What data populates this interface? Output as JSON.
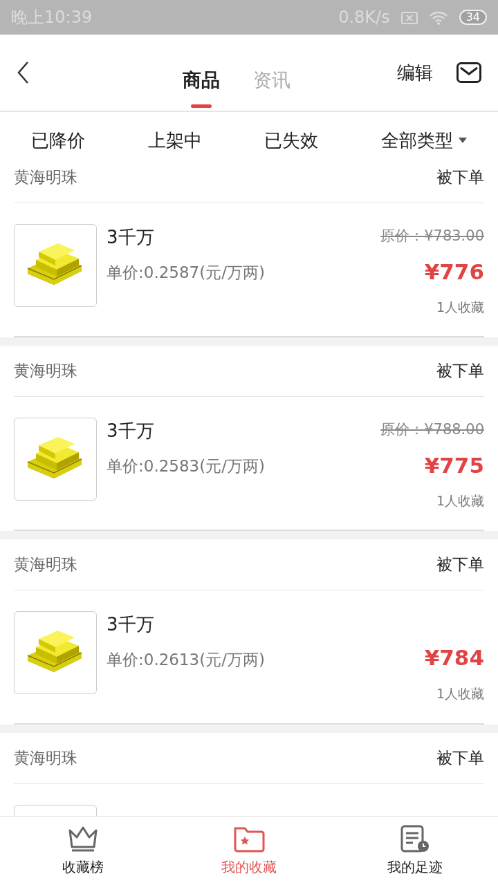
{
  "status_bar": {
    "time": "晚上10:39",
    "speed": "0.8K/s",
    "battery": "34"
  },
  "header": {
    "tabs": [
      {
        "label": "商品",
        "selected": true
      },
      {
        "label": "资讯",
        "selected": false
      }
    ],
    "edit": "编辑"
  },
  "filters": [
    {
      "label": "已降价",
      "kind": "plain"
    },
    {
      "label": "上架中",
      "kind": "plain"
    },
    {
      "label": "已失效",
      "kind": "plain"
    },
    {
      "label": "全部类型",
      "kind": "dropdown"
    }
  ],
  "items": [
    {
      "shop": "黄海明珠",
      "status": "被下单",
      "name": "3千万",
      "unit_price": "单价:0.2587(元/万两)",
      "original_price": "原价：¥783.00",
      "price": "¥776",
      "favorites": "1人收藏"
    },
    {
      "shop": "黄海明珠",
      "status": "被下单",
      "name": "3千万",
      "unit_price": "单价:0.2583(元/万两)",
      "original_price": "原价：¥788.00",
      "price": "¥775",
      "favorites": "1人收藏"
    },
    {
      "shop": "黄海明珠",
      "status": "被下单",
      "name": "3千万",
      "unit_price": "单价:0.2613(元/万两)",
      "price": "¥784",
      "favorites": "1人收藏"
    },
    {
      "shop": "黄海明珠",
      "status": "被下单"
    }
  ],
  "bottom_nav": [
    {
      "label": "收藏榜",
      "kind": "crown",
      "selected": false
    },
    {
      "label": "我的收藏",
      "kind": "folder",
      "selected": true
    },
    {
      "label": "我的足迹",
      "kind": "history",
      "selected": false
    }
  ]
}
